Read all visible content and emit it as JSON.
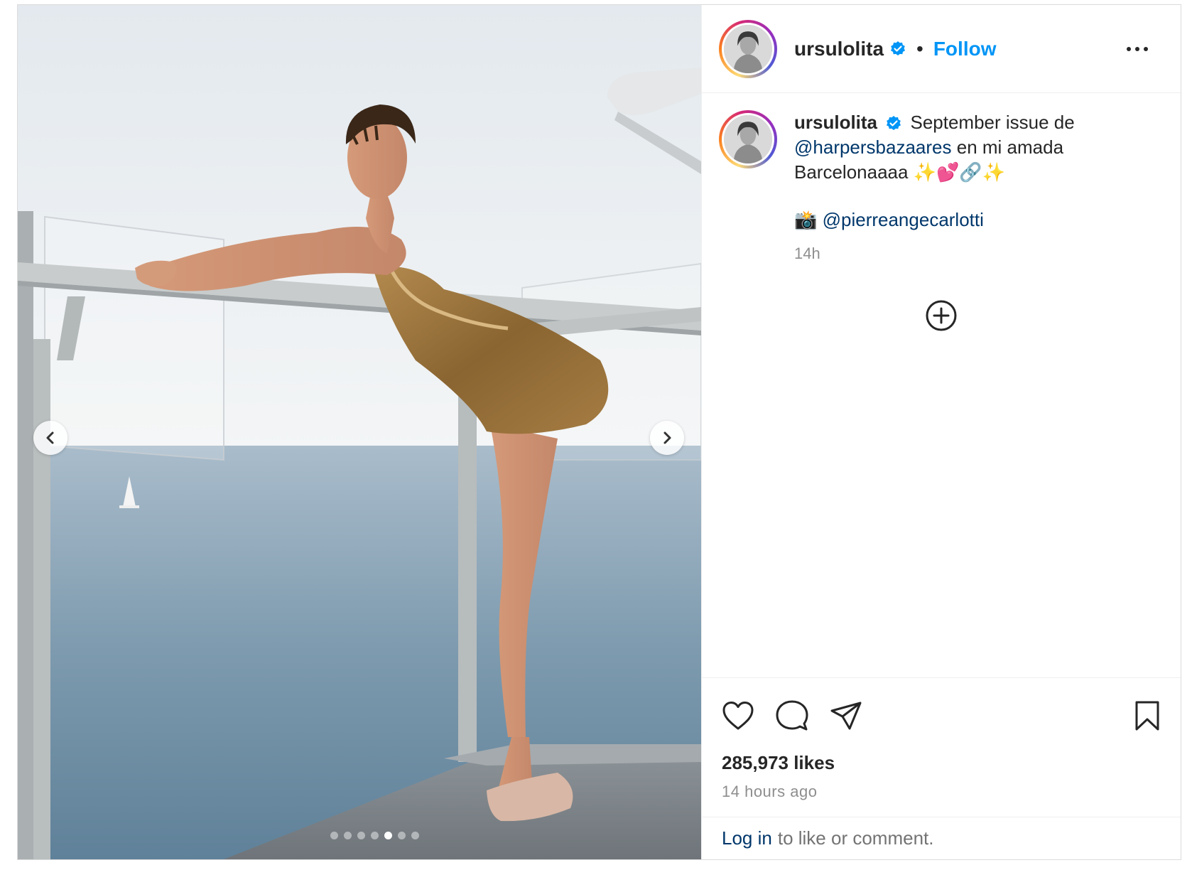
{
  "post": {
    "username": "ursulolita",
    "follow_label": "Follow",
    "separator": "•",
    "caption": {
      "username": "ursulolita",
      "text_part1": "September issue de",
      "mention1": "@harpersbazaares",
      "text_part2": "en mi amada Barcelonaaaa ✨💕🔗✨",
      "photo_emoji": "📸",
      "mention2": "@pierreangecarlotti",
      "time_short": "14h"
    },
    "likes": "285,973 likes",
    "time_ago": "14 hours ago",
    "login_link": "Log in",
    "login_rest": "to like or comment.",
    "carousel": {
      "total": 7,
      "active_index": 4
    }
  },
  "icons": {
    "verified": "verified-badge-icon",
    "more": "more-options-icon",
    "prev": "chevron-left-icon",
    "next": "chevron-right-icon",
    "add": "add-circle-icon",
    "like": "heart-icon",
    "comment": "comment-icon",
    "share": "share-icon",
    "save": "bookmark-icon"
  },
  "colors": {
    "follow": "#0095f6",
    "mention": "#00376b",
    "verified": "#0095f6"
  }
}
